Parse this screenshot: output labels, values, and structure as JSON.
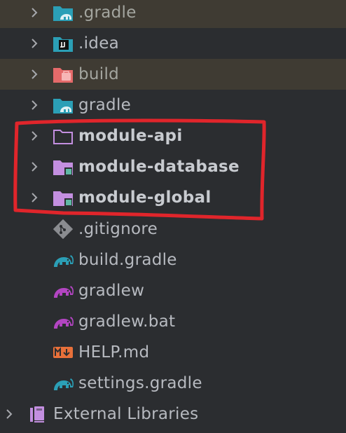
{
  "tree": {
    "items": [
      {
        "label": ".gradle",
        "icon": "gradle-folder-icon",
        "excluded": true
      },
      {
        "label": ".idea",
        "icon": "idea-folder-icon"
      },
      {
        "label": "build",
        "icon": "build-folder-icon",
        "excluded": true
      },
      {
        "label": "gradle",
        "icon": "gradle-folder-icon"
      },
      {
        "label": "module-api",
        "icon": "folder-outline-icon"
      },
      {
        "label": "module-database",
        "icon": "module-folder-icon"
      },
      {
        "label": "module-global",
        "icon": "module-folder-icon"
      },
      {
        "label": ".gitignore",
        "icon": "git-icon"
      },
      {
        "label": "build.gradle",
        "icon": "gradle-elephant-icon"
      },
      {
        "label": "gradlew",
        "icon": "gradle-elephant-purple-icon"
      },
      {
        "label": "gradlew.bat",
        "icon": "gradle-elephant-purple-icon"
      },
      {
        "label": "HELP.md",
        "icon": "markdown-icon"
      },
      {
        "label": "settings.gradle",
        "icon": "gradle-elephant-icon"
      }
    ],
    "external_libraries": {
      "label": "External Libraries",
      "icon": "library-icon"
    }
  },
  "colors": {
    "highlight": "#e0252b",
    "folder_teal": "#2b9fb6",
    "module_purple": "#c38fe0",
    "build_red": "#e56a6a",
    "gradle_purple": "#b345c2",
    "markdown_orange": "#e8703a"
  }
}
